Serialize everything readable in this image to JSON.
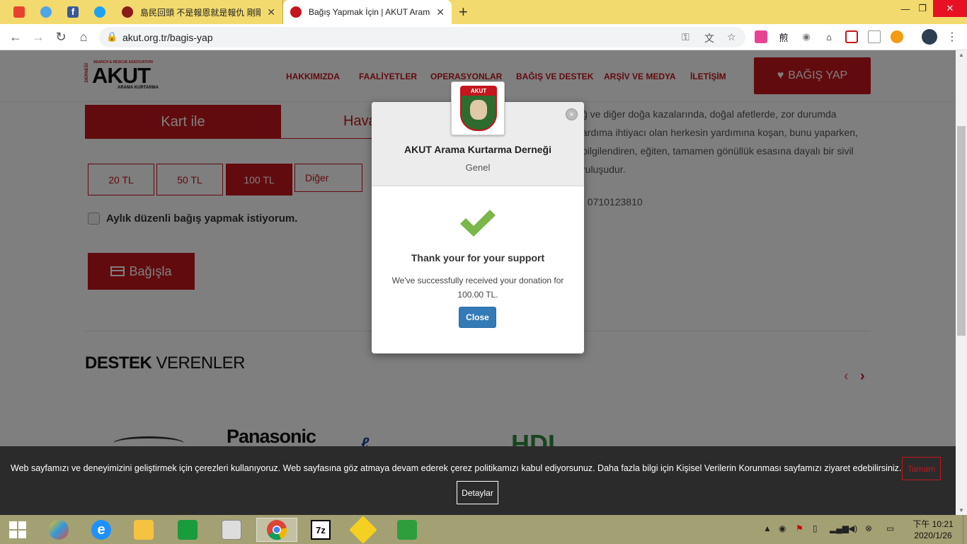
{
  "browser": {
    "tabs": [
      {
        "title": "島民回頭 不是報恩就是報仇 剛剛",
        "active": false
      },
      {
        "title": "Bağış Yapmak İçin | AKUT Arama Kurtarma Derneği",
        "active": true
      }
    ],
    "new_tab_glyph": "+",
    "window_controls": {
      "minimize": "—",
      "maximize": "❐",
      "close": "✕"
    },
    "url": "akut.org.tr/bagis-yap",
    "nav": {
      "back": "←",
      "forward": "→",
      "reload": "↻",
      "home": "⌂"
    }
  },
  "site": {
    "logo": {
      "main": "AKUT",
      "sub": "ARAMA KURTARMA",
      "top": "SEARCH & RESCUE ASSOCIATION",
      "side": "DERNEĞİ"
    },
    "nav": [
      "HAKKIMIZDA",
      "FAALİYETLER",
      "OPERASYONLAR",
      "BAĞIŞ VE DESTEK",
      "ARŞİV VE MEDYA",
      "İLETİŞİM"
    ],
    "donate_button": "BAĞIŞ YAP",
    "payment_tabs": {
      "card": "Kart ile",
      "transfer": "Havale"
    },
    "amounts": [
      {
        "label": "20 TL",
        "selected": false
      },
      {
        "label": "50 TL",
        "selected": false
      },
      {
        "label": "100 TL",
        "selected": true
      }
    ],
    "other_placeholder": "Diğer",
    "monthly_label": "Aylık düzenli bağış yapmak istiyorum.",
    "submit_label": "Bağışla",
    "about_lines": [
      "ğ ve diğer doğa kazalarında, doğal afetlerde, zor durumda",
      "ardıma ihtiyacı olan herkesin yardımına koşan, bunu yaparken,",
      "bilgilendiren, eğiten, tamamen gönüllük esasına dayalı bir sivil",
      "ruluşudur.",
      ": 0710123810"
    ],
    "sponsors_title_bold": "DESTEK",
    "sponsors_title_rest": " VERENLER",
    "sponsor_logos": [
      "Panasonic",
      "HDI"
    ]
  },
  "modal": {
    "org_name": "AKUT Arama Kurtarma Derneği",
    "category": "Genel",
    "logo_text": "AKUT",
    "title": "Thank your for your support",
    "message": "We've successfully received your donation for 100.00 TL.",
    "close_label": "Close",
    "close_x": "×"
  },
  "cookie": {
    "message": "Web sayfamızı ve deneyimizini geliştirmek için çerezleri kullanıyoruz. Web sayfasına göz atmaya devam ederek çerez politikamızı kabul ediyorsunuz. Daha fazla bilgi için Kişisel Verilerin Korunması sayfamızı ziyaret edebilirsiniz.",
    "accept": "Tamam",
    "details": "Detaylar"
  },
  "taskbar": {
    "apps": [
      "ie-icon",
      "explorer-icon",
      "store-icon",
      "notepad-icon",
      "chrome-icon",
      "7zip-icon",
      "app-icon",
      "calculator-icon"
    ],
    "zip_label": "7z",
    "clock_time": "下午 10:21",
    "clock_date": "2020/1/26"
  },
  "colors": {
    "brand_red": "#c4161c",
    "modal_button": "#337ab7",
    "check_green": "#7ab648"
  }
}
